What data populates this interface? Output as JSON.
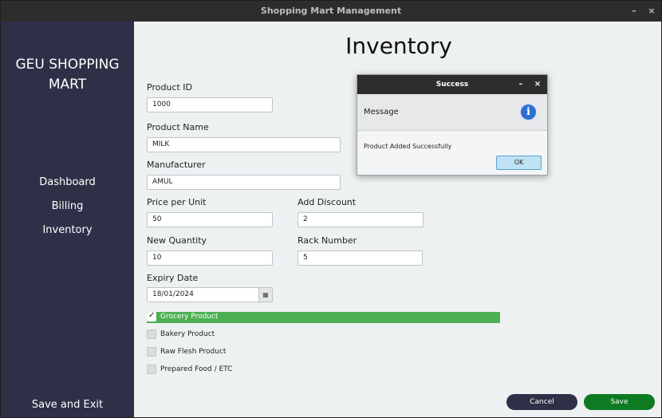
{
  "window": {
    "title": "Shopping Mart Management",
    "minimize_glyph": "–",
    "close_glyph": "×"
  },
  "sidebar": {
    "brand_line1": "GEU SHOPPING",
    "brand_line2": "MART",
    "items": [
      {
        "label": "Dashboard"
      },
      {
        "label": "Billing"
      },
      {
        "label": "Inventory"
      }
    ],
    "save_exit": "Save and Exit"
  },
  "main": {
    "title": "Inventory",
    "product_id": {
      "label": "Product ID",
      "value": "1000"
    },
    "product_name": {
      "label": "Product Name",
      "value": "MILK"
    },
    "manufacturer": {
      "label": "Manufacturer",
      "value": "AMUL"
    },
    "price": {
      "label": "Price per Unit",
      "value": "50"
    },
    "discount": {
      "label": "Add Discount",
      "value": "2"
    },
    "quantity": {
      "label": "New Quantity",
      "value": "10"
    },
    "rack": {
      "label": "Rack Number",
      "value": "5"
    },
    "expiry": {
      "label": "Expiry Date",
      "value": "18/01/2024",
      "icon": "calendar-icon"
    },
    "categories": [
      {
        "label": "Grocery Product",
        "checked": true
      },
      {
        "label": "Bakery Product",
        "checked": false
      },
      {
        "label": "Raw Flesh Product",
        "checked": false
      },
      {
        "label": "Prepared Food / ETC",
        "checked": false
      }
    ],
    "cancel_label": "Cancel",
    "save_label": "Save"
  },
  "dialog": {
    "title": "Success",
    "header": "Message",
    "message": "Product Added Successfully",
    "ok_label": "OK",
    "icon": "info-icon",
    "icon_glyph": "i"
  },
  "colors": {
    "sidebar": "#2e3047",
    "selected_row": "#4cb052",
    "save_button": "#0e7a22",
    "info_icon": "#2d6fd0"
  }
}
